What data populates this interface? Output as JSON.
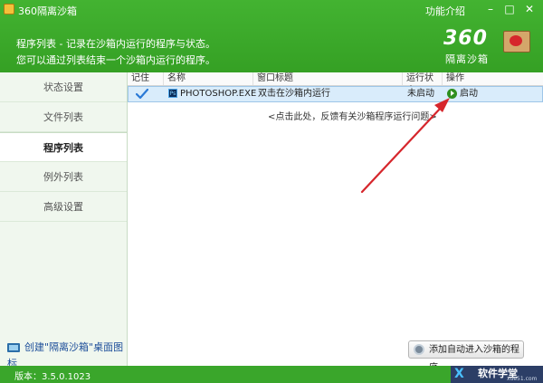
{
  "window": {
    "title": "360隔离沙箱",
    "menu_label": "功能介绍",
    "btn_min": "–",
    "btn_max": "□",
    "btn_close": "✕"
  },
  "header": {
    "line1": "程序列表 - 记录在沙箱内运行的程序与状态。",
    "line2": "您可以通过列表结束一个沙箱内运行的程序。",
    "logo_number": "360",
    "logo_text": "隔离沙箱"
  },
  "sidebar": {
    "items": [
      {
        "label": "状态设置"
      },
      {
        "label": "文件列表"
      },
      {
        "label": "程序列表"
      },
      {
        "label": "例外列表"
      },
      {
        "label": "高级设置"
      }
    ],
    "active_index": 2,
    "create_shortcut": "创建\"隔离沙箱\"桌面图标"
  },
  "table": {
    "columns": [
      "记住",
      "名称",
      "窗口标题",
      "运行状态",
      "操作"
    ],
    "rows": [
      {
        "remembered": true,
        "name": "PHOTOSHOP.EXE",
        "window_title": "双击在沙箱内运行",
        "status": "未启动",
        "action": "启动"
      }
    ],
    "feedback_link": "<点击此处，反馈有关沙箱程序运行问题>"
  },
  "footer": {
    "add_button": "添加自动进入沙箱的程序",
    "version": "版本：3.5.0.1023"
  },
  "brand": {
    "logo_mark": "X",
    "name": "软件学堂",
    "url": "xue51.com"
  },
  "colors": {
    "accent_green": "#3aa62b",
    "arrow_red": "#d6262c",
    "selection_blue": "#d9ecfb"
  }
}
